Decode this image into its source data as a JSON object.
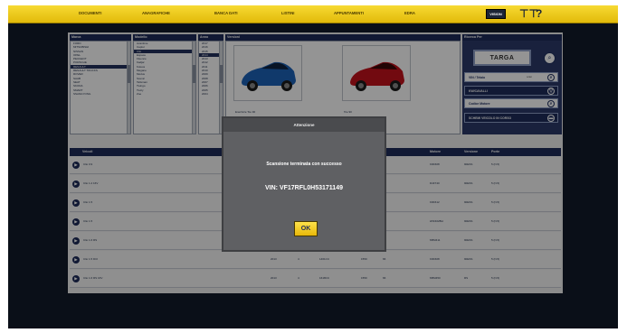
{
  "topbar": {
    "menu": [
      "DOCUMENTI",
      "ANAGRAFICHE",
      "BANCA DATI",
      "LISTINI",
      "APPUNTAMENTI",
      "EDRA"
    ],
    "user_button": "VISION",
    "tools_icon": "tools-icon",
    "help_icon": "help-icon"
  },
  "columns": {
    "marca": "Marca",
    "modello": "Modello",
    "anno": "Anno",
    "versioni": "Versioni",
    "ricerca": "Ricerca Per"
  },
  "marca_list": [
    "FORD",
    "MITSUBISHI",
    "NISSAN",
    "OPEL",
    "PEUGEOT",
    "PORSCHE",
    "RENAULT",
    "RENAULT TRUCKS",
    "ROVER",
    "SAAB",
    "SEAT",
    "SKODA",
    "SMART",
    "SSANGYONG"
  ],
  "modello_list": [
    "Avantime",
    "Captur",
    "Clio",
    "Espace",
    "Fluence",
    "Kadjar",
    "Koleos",
    "Megane",
    "Modus",
    "Scenic",
    "Talisman",
    "Twingo",
    "Twizy",
    "Zoe"
  ],
  "anno_list": [
    "2017",
    "2016",
    "2015",
    "2014",
    "2013",
    "2012",
    "2011",
    "2010",
    "2009",
    "2008",
    "2007",
    "2006",
    "2005",
    "2004"
  ],
  "versions": [
    {
      "caption": "EnerGize Tce 90"
    },
    {
      "caption": "Tce 90"
    }
  ],
  "search": {
    "targa": "TARGA",
    "vin_label": "VIN / Telaio",
    "vin_hint": "scan",
    "kw_label": "KW/CAVALLI",
    "codice_motore": "Codice Motore",
    "ricerca_libera": "SCHEMI VEICOLO IN CORSO"
  },
  "table": {
    "headers": [
      "Veicoli",
      "Motore",
      "Versione",
      "Porte"
    ],
    "rows": [
      {
        "name": "Clio 0.9",
        "cols": [
          "",
          "",
          "",
          "",
          "",
          "",
          "K9K608",
          "90ESS",
          "5 (N.5)"
        ]
      },
      {
        "name": "Clio 1.2 16V",
        "cols": [
          "",
          "",
          "",
          "",
          "",
          "",
          "D4F740",
          "90ESS",
          "5 (N.5)"
        ]
      },
      {
        "name": "Clio 1.5",
        "cols": [
          "",
          "",
          "",
          "",
          "",
          "",
          "K9K612",
          "90ESS",
          "5 (N.5)"
        ]
      },
      {
        "name": "Clio 1.5",
        "cols": [
          "",
          "",
          "",
          "",
          "",
          "",
          "H5F402BH",
          "90ESS",
          "5 (N.5)"
        ]
      },
      {
        "name": "Clio 1.6 RS",
        "cols": [
          "",
          "",
          "",
          "",
          "",
          "",
          "M5M411",
          "90ESS",
          "5 (N.5)"
        ]
      },
      {
        "name": "Clio 1.5 DCI",
        "cols": [
          "2013",
          "4",
          "1461CC",
          "1550",
          "66",
          "K9K608",
          "90ESS",
          "5 (N.5)"
        ]
      },
      {
        "name": "Clio 1.6 RS 16V",
        "cols": [
          "2013",
          "4",
          "1618CC",
          "1550",
          "66",
          "M5M450",
          "RS",
          "5 (N.5)"
        ]
      }
    ]
  },
  "dialog": {
    "title": "Attenzione",
    "message": "Scansione terminata con successo",
    "vin": "VIN: VF17RFL0H53171149",
    "ok": "OK"
  }
}
